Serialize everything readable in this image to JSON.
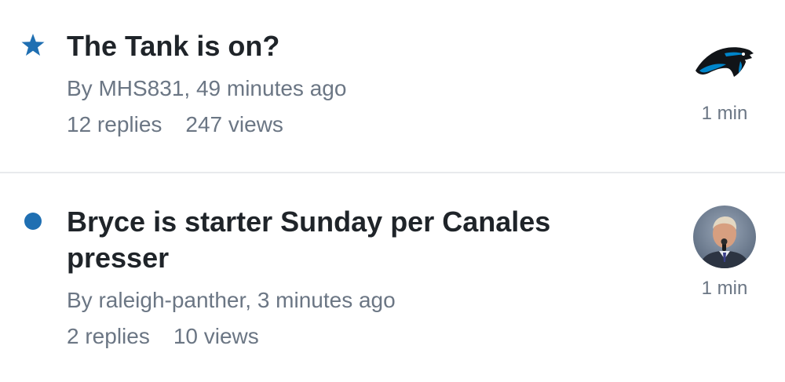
{
  "topics": [
    {
      "title": "The Tank is on?",
      "byline": "By MHS831, 49 minutes ago",
      "replies": "12 replies",
      "views": "247 views",
      "time": "1 min",
      "status_icon": "star-icon",
      "avatar": "panthers-logo"
    },
    {
      "title": "Bryce is starter Sunday per Canales presser",
      "byline": "By raleigh-panther, 3 minutes ago",
      "replies": "2 replies",
      "views": "10 views",
      "time": "1 min",
      "status_icon": "unread-dot-icon",
      "avatar": "user-photo"
    }
  ],
  "colors": {
    "accent": "#1f6fb2",
    "title": "#1f2429",
    "meta": "#6b7684",
    "divider": "#e8eaed"
  }
}
